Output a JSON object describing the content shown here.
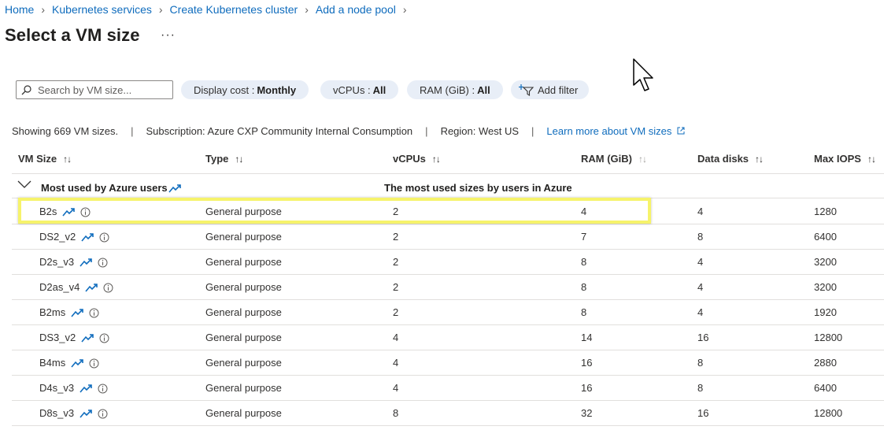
{
  "breadcrumb": [
    "Home",
    "Kubernetes services",
    "Create Kubernetes cluster",
    "Add a node pool"
  ],
  "page": {
    "title": "Select a VM size",
    "more": "···"
  },
  "search": {
    "placeholder": "Search by VM size..."
  },
  "filters": {
    "display_cost": {
      "label": "Display cost :",
      "value": "Monthly"
    },
    "vcpus": {
      "label": "vCPUs :",
      "value": "All"
    },
    "ram": {
      "label": "RAM (GiB) :",
      "value": "All"
    },
    "add_filter": "Add filter"
  },
  "summary": {
    "showing": "Showing 669 VM sizes.",
    "subscription": "Subscription: Azure CXP Community Internal Consumption",
    "region": "Region: West US",
    "learn_more": "Learn more about VM sizes",
    "separator": "|"
  },
  "table": {
    "columns": [
      "VM Size",
      "Type",
      "vCPUs",
      "RAM (GiB)",
      "Data disks",
      "Max IOPS"
    ],
    "sort_glyph": "↑↓",
    "group": {
      "label": "Most used by Azure users",
      "description": "The most used sizes by users in Azure"
    },
    "rows": [
      {
        "name": "B2s",
        "type": "General purpose",
        "vcpus": "2",
        "ram": "4",
        "disks": "4",
        "iops": "1280"
      },
      {
        "name": "DS2_v2",
        "type": "General purpose",
        "vcpus": "2",
        "ram": "7",
        "disks": "8",
        "iops": "6400"
      },
      {
        "name": "D2s_v3",
        "type": "General purpose",
        "vcpus": "2",
        "ram": "8",
        "disks": "4",
        "iops": "3200"
      },
      {
        "name": "D2as_v4",
        "type": "General purpose",
        "vcpus": "2",
        "ram": "8",
        "disks": "4",
        "iops": "3200"
      },
      {
        "name": "B2ms",
        "type": "General purpose",
        "vcpus": "2",
        "ram": "8",
        "disks": "4",
        "iops": "1920"
      },
      {
        "name": "DS3_v2",
        "type": "General purpose",
        "vcpus": "4",
        "ram": "14",
        "disks": "16",
        "iops": "12800"
      },
      {
        "name": "B4ms",
        "type": "General purpose",
        "vcpus": "4",
        "ram": "16",
        "disks": "8",
        "iops": "2880"
      },
      {
        "name": "D4s_v3",
        "type": "General purpose",
        "vcpus": "4",
        "ram": "16",
        "disks": "8",
        "iops": "6400"
      },
      {
        "name": "D8s_v3",
        "type": "General purpose",
        "vcpus": "8",
        "ram": "32",
        "disks": "16",
        "iops": "12800"
      }
    ],
    "highlighted_row": "B2s"
  },
  "colors": {
    "link": "#0f6cbd",
    "pill": "#e8eef7",
    "highlight": "#f6f36b",
    "trend": "#0f6cbd"
  }
}
